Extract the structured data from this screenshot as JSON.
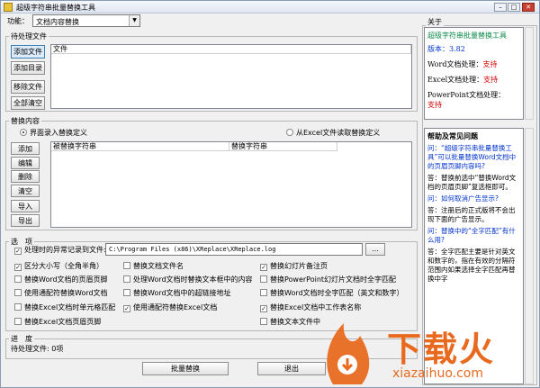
{
  "window": {
    "title": "超级字符串批量替换工具"
  },
  "func": {
    "label": "功能：",
    "value": "文档内容替换"
  },
  "pending": {
    "group_label": "待处理文件",
    "buttons": [
      "添加文件",
      "添加目录",
      "移除文件",
      "全部清空"
    ],
    "column": "文件"
  },
  "replace": {
    "group_label": "替换内容",
    "radio_manual": "界面录入替换定义",
    "radio_excel": "从Excel文件读取替换定义",
    "buttons": [
      "添加",
      "编辑",
      "删除",
      "清空",
      "导入",
      "导出"
    ],
    "columns": [
      "被替换字符串",
      "替换字符串"
    ]
  },
  "options": {
    "group_label": "选　项",
    "log_label": "处理时的异常记录到文件:",
    "log_path": "C:\\Program Files (x86)\\XReplace\\XReplace.log",
    "browse": "...",
    "items": [
      {
        "label": "区分大小写（全角半角）",
        "checked": true
      },
      {
        "label": "替换Word文档的页眉页脚",
        "checked": false
      },
      {
        "label": "使用通配符替换Word文档",
        "checked": false
      },
      {
        "label": "替换Excel文档时单元格匹配",
        "checked": false
      },
      {
        "label": "替换Excel文档页眉页脚",
        "checked": false
      },
      {
        "label": "替换文档文件名",
        "checked": false
      },
      {
        "label": "处理Word文档时替换文本框中的内容",
        "checked": false
      },
      {
        "label": "替换Word文档中的超链接地址",
        "checked": false
      },
      {
        "label": "使用通配符替换Excel文档",
        "checked": true
      },
      {
        "label": "替换幻灯片备注页",
        "checked": true
      },
      {
        "label": "替换PowerPoint幻灯片文档时全字匹配",
        "checked": false
      },
      {
        "label": "替换Word文档时全字匹配（英文和数字）",
        "checked": false
      },
      {
        "label": "替换Excel文档中工作表名称",
        "checked": true
      },
      {
        "label": "替换文本文件中",
        "checked": false
      }
    ]
  },
  "progress": {
    "group_label": "进　度",
    "pending_text": "待处理文件: 0项"
  },
  "bottom": {
    "start": "批量替换",
    "exit": "退出"
  },
  "about": {
    "group_label": "关于",
    "name": "超级字符串批量替换工具",
    "version_label": "版本：",
    "version": "3.82",
    "word_label": "Word文档处理：",
    "excel_label": "Excel文档处理：",
    "ppt_label": "PowerPoint文档处理：",
    "support": "支持"
  },
  "help": {
    "title": "帮助及常见问题",
    "qa": [
      {
        "q": "问：“超级字符串批量替换工具”可以批量替换Word文档中的页眉页脚内容吗?",
        "a": "答：替换前选中“替换Word文档的页眉页脚”复选框即可。"
      },
      {
        "q": "问：如何取消广告显示?",
        "a": "答：注册后的正式版将不会出现下面的广告显示。"
      },
      {
        "q": "问：替换中的“全字匹配”有什么用?",
        "a": "答：全字匹配主要是针对英文和数字的，指在有效的分隔符范围内如果选择全字匹配再替换中字"
      }
    ]
  },
  "watermark": {
    "cn": "下载火",
    "en": "xiazaihuo.com"
  }
}
